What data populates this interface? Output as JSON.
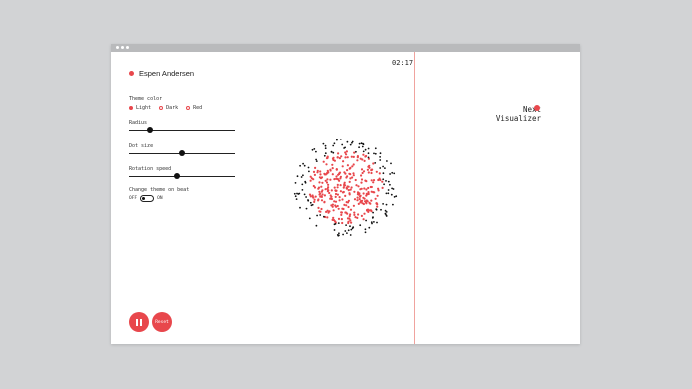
{
  "user": {
    "name": "Espen Andersen"
  },
  "timer": "02:17",
  "controls": {
    "theme_label": "Theme color",
    "theme_options": [
      "Light",
      "Dark",
      "Red"
    ],
    "theme_selected": "Light",
    "radius_label": "Radius",
    "radius_value": 0.2,
    "dot_size_label": "Dot size",
    "dot_size_value": 0.5,
    "rotation_label": "Rotation speed",
    "rotation_value": 0.45,
    "beat_label": "Change theme on beat",
    "beat_off": "OFF",
    "beat_on": "ON",
    "beat_state": "OFF"
  },
  "buttons": {
    "reset": "Reset"
  },
  "next": {
    "line1": "Next",
    "line2": "Visualizer"
  },
  "colors": {
    "accent": "#e8474c",
    "divider": "#f0a39e"
  }
}
